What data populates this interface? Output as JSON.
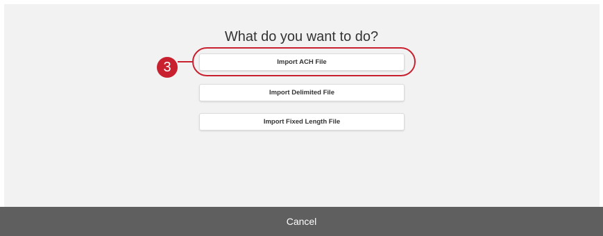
{
  "dialog": {
    "title": "What do you want to do?",
    "options": [
      {
        "label": "Import ACH File"
      },
      {
        "label": "Import Delimited File"
      },
      {
        "label": "Import Fixed Length File"
      }
    ]
  },
  "annotation": {
    "step_number": "3",
    "highlight_color": "#c8202f"
  },
  "footer": {
    "cancel_label": "Cancel"
  }
}
